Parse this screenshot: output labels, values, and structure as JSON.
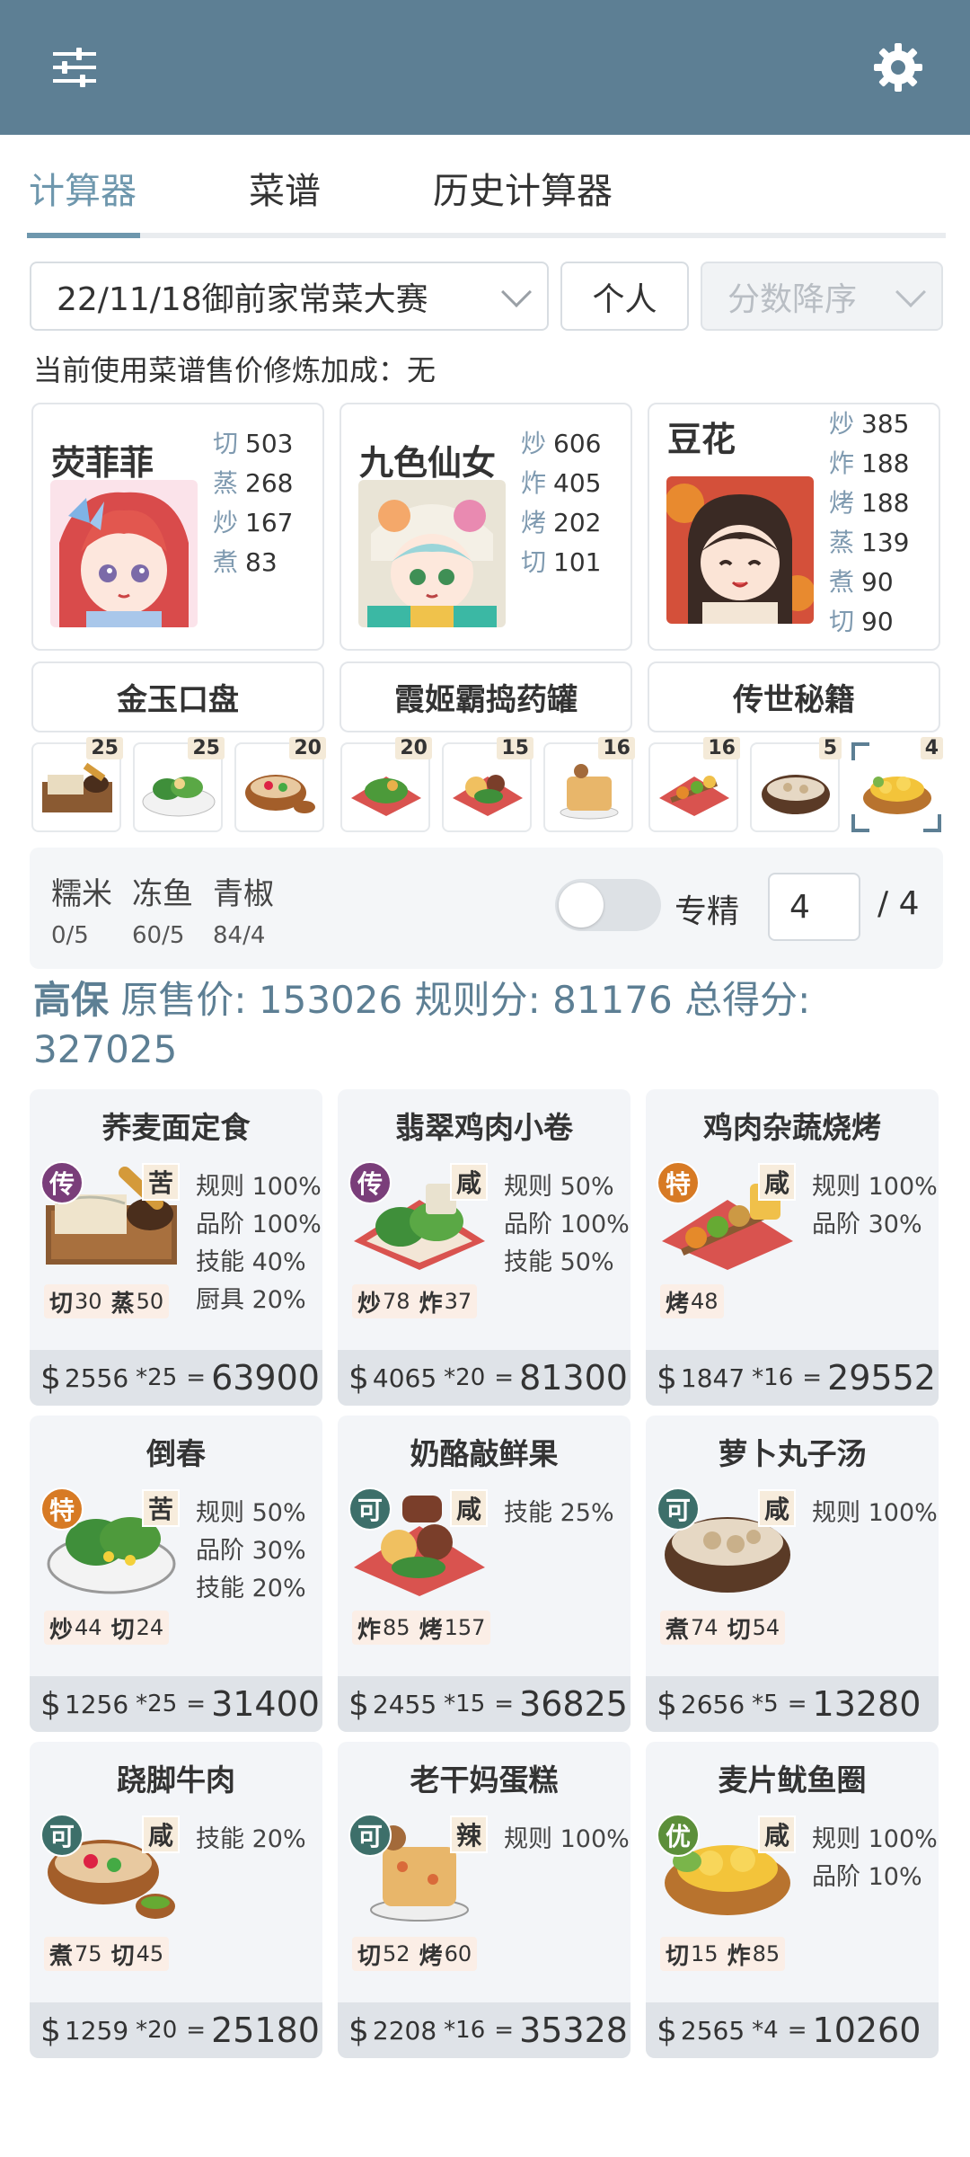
{
  "appbar": {
    "menu_icon": "sliders-icon",
    "settings_icon": "gear-icon"
  },
  "tabs": [
    {
      "label": "计算器",
      "active": true
    },
    {
      "label": "菜谱",
      "active": false
    },
    {
      "label": "历史计算器",
      "active": false
    }
  ],
  "filters": {
    "contest": "22/11/18御前家常菜大赛",
    "mode": "个人",
    "sort": "分数降序"
  },
  "note": "当前使用菜谱售价修炼加成：无",
  "chefs": [
    {
      "name": "荧菲菲",
      "skills": [
        {
          "k": "切",
          "v": "503"
        },
        {
          "k": "蒸",
          "v": "268"
        },
        {
          "k": "炒",
          "v": "167"
        },
        {
          "k": "煮",
          "v": "83"
        }
      ]
    },
    {
      "name": "九色仙女",
      "skills": [
        {
          "k": "炒",
          "v": "606"
        },
        {
          "k": "炸",
          "v": "405"
        },
        {
          "k": "烤",
          "v": "202"
        },
        {
          "k": "切",
          "v": "101"
        }
      ]
    },
    {
      "name": "豆花",
      "skills": [
        {
          "k": "炒",
          "v": "385"
        },
        {
          "k": "炸",
          "v": "188"
        },
        {
          "k": "烤",
          "v": "188"
        },
        {
          "k": "蒸",
          "v": "139"
        },
        {
          "k": "煮",
          "v": "90"
        },
        {
          "k": "切",
          "v": "90"
        }
      ]
    }
  ],
  "equipment": [
    "金玉口盘",
    "霞姬霸捣药罐",
    "传世秘籍"
  ],
  "dish_slots": [
    "25",
    "25",
    "20",
    "20",
    "15",
    "16",
    "16",
    "5",
    "4"
  ],
  "materials": [
    {
      "name": "糯米",
      "value": "0/5"
    },
    {
      "name": "冻鱼",
      "value": "60/5"
    },
    {
      "name": "青椒",
      "value": "84/4"
    }
  ],
  "specialize": {
    "label": "专精",
    "value": "4",
    "max": "/ 4",
    "on": false
  },
  "summary": {
    "level": "高保",
    "orig_label": "原售价:",
    "orig_value": "153026",
    "rule_label": "规则分:",
    "rule_value": "81176",
    "total_label": "总得分:",
    "total_value": "327025"
  },
  "recipes": [
    {
      "name": "荞麦面定食",
      "rank": "传",
      "taste": "苦",
      "rules": [
        "规则 100%",
        "品阶 100%",
        "技能 40%",
        "厨具 20%"
      ],
      "skills": [
        {
          "k": "切",
          "v": "30"
        },
        {
          "k": "蒸",
          "v": "50"
        }
      ],
      "price": "2556",
      "qty": "*25",
      "total": "63900"
    },
    {
      "name": "翡翠鸡肉小卷",
      "rank": "传",
      "taste": "咸",
      "rules": [
        "规则 50%",
        "品阶 100%",
        "技能 50%"
      ],
      "skills": [
        {
          "k": "炒",
          "v": "78"
        },
        {
          "k": "炸",
          "v": "37"
        }
      ],
      "price": "4065",
      "qty": "*20",
      "total": "81300"
    },
    {
      "name": "鸡肉杂蔬烧烤",
      "rank": "特",
      "taste": "咸",
      "rules": [
        "规则 100%",
        "品阶 30%"
      ],
      "skills": [
        {
          "k": "烤",
          "v": "48"
        }
      ],
      "price": "1847",
      "qty": "*16",
      "total": "29552"
    },
    {
      "name": "倒春",
      "rank": "特",
      "taste": "苦",
      "rules": [
        "规则 50%",
        "品阶 30%",
        "技能 20%"
      ],
      "skills": [
        {
          "k": "炒",
          "v": "44"
        },
        {
          "k": "切",
          "v": "24"
        }
      ],
      "price": "1256",
      "qty": "*25",
      "total": "31400"
    },
    {
      "name": "奶酪敲鲜果",
      "rank": "可",
      "taste": "咸",
      "rules": [
        "技能 25%"
      ],
      "skills": [
        {
          "k": "炸",
          "v": "85"
        },
        {
          "k": "烤",
          "v": "157"
        }
      ],
      "price": "2455",
      "qty": "*15",
      "total": "36825"
    },
    {
      "name": "萝卜丸子汤",
      "rank": "可",
      "taste": "咸",
      "rules": [
        "规则 100%"
      ],
      "skills": [
        {
          "k": "煮",
          "v": "74"
        },
        {
          "k": "切",
          "v": "54"
        }
      ],
      "price": "2656",
      "qty": "*5",
      "total": "13280"
    },
    {
      "name": "跷脚牛肉",
      "rank": "可",
      "taste": "咸",
      "rules": [
        "技能 20%"
      ],
      "skills": [
        {
          "k": "煮",
          "v": "75"
        },
        {
          "k": "切",
          "v": "45"
        }
      ],
      "price": "1259",
      "qty": "*20",
      "total": "25180"
    },
    {
      "name": "老干妈蛋糕",
      "rank": "可",
      "taste": "辣",
      "rules": [
        "规则 100%"
      ],
      "skills": [
        {
          "k": "切",
          "v": "52"
        },
        {
          "k": "烤",
          "v": "60"
        }
      ],
      "price": "2208",
      "qty": "*16",
      "total": "35328"
    },
    {
      "name": "麦片鱿鱼圈",
      "rank": "优",
      "taste": "咸",
      "rules": [
        "规则 100%",
        "品阶 10%"
      ],
      "skills": [
        {
          "k": "切",
          "v": "15"
        },
        {
          "k": "炸",
          "v": "85"
        }
      ],
      "price": "2565",
      "qty": "*4",
      "total": "10260"
    }
  ],
  "currency_symbol": "$",
  "equals": "=",
  "colors": {
    "appbar": "#5d7f94",
    "accent": "#6e97ad",
    "rank_chuan": "#7a3e7a",
    "rank_te": "#d77a24",
    "rank_ke": "#3d6f6a",
    "rank_you": "#5c8f3a"
  }
}
